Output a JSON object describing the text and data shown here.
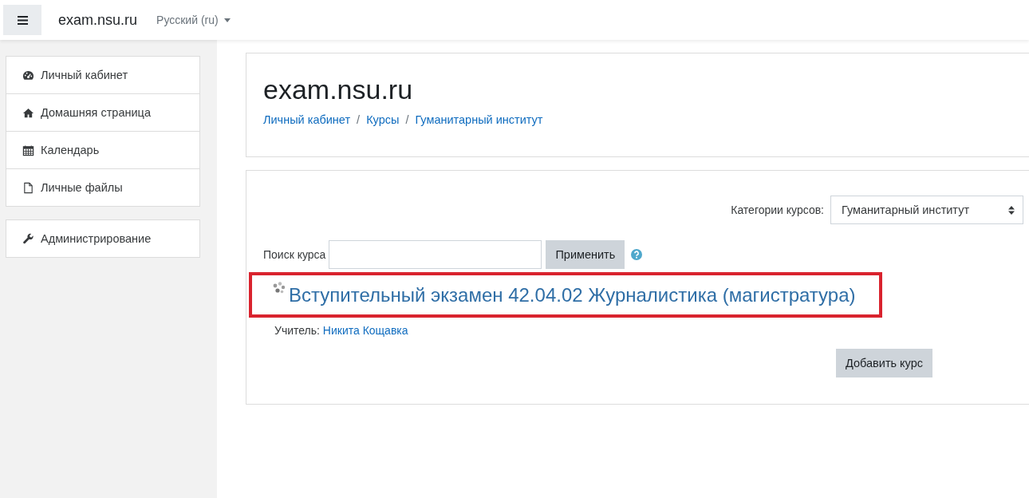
{
  "navbar": {
    "site_name": "exam.nsu.ru",
    "language": "Русский (ru)"
  },
  "sidebar": {
    "groups": [
      {
        "items": [
          {
            "label": "Личный кабинет"
          },
          {
            "label": "Домашняя страница"
          },
          {
            "label": "Календарь"
          },
          {
            "label": "Личные файлы"
          }
        ]
      },
      {
        "items": [
          {
            "label": "Администрирование"
          }
        ]
      }
    ]
  },
  "header": {
    "title": "exam.nsu.ru",
    "breadcrumbs": [
      "Личный кабинет",
      "Курсы",
      "Гуманитарный институт"
    ],
    "separators": [
      "/",
      "/"
    ]
  },
  "category": {
    "label": "Категории курсов:",
    "value": "Гуманитарный институт"
  },
  "search": {
    "label": "Поиск курса",
    "button": "Применить"
  },
  "course": {
    "title": "Вступительный экзамен 42.04.02 Журналистика (магистратура)",
    "highlighted": true,
    "teacher_label": "Учитель:",
    "teacher": "Никита Кощавка"
  },
  "add_button": "Добавить курс"
}
